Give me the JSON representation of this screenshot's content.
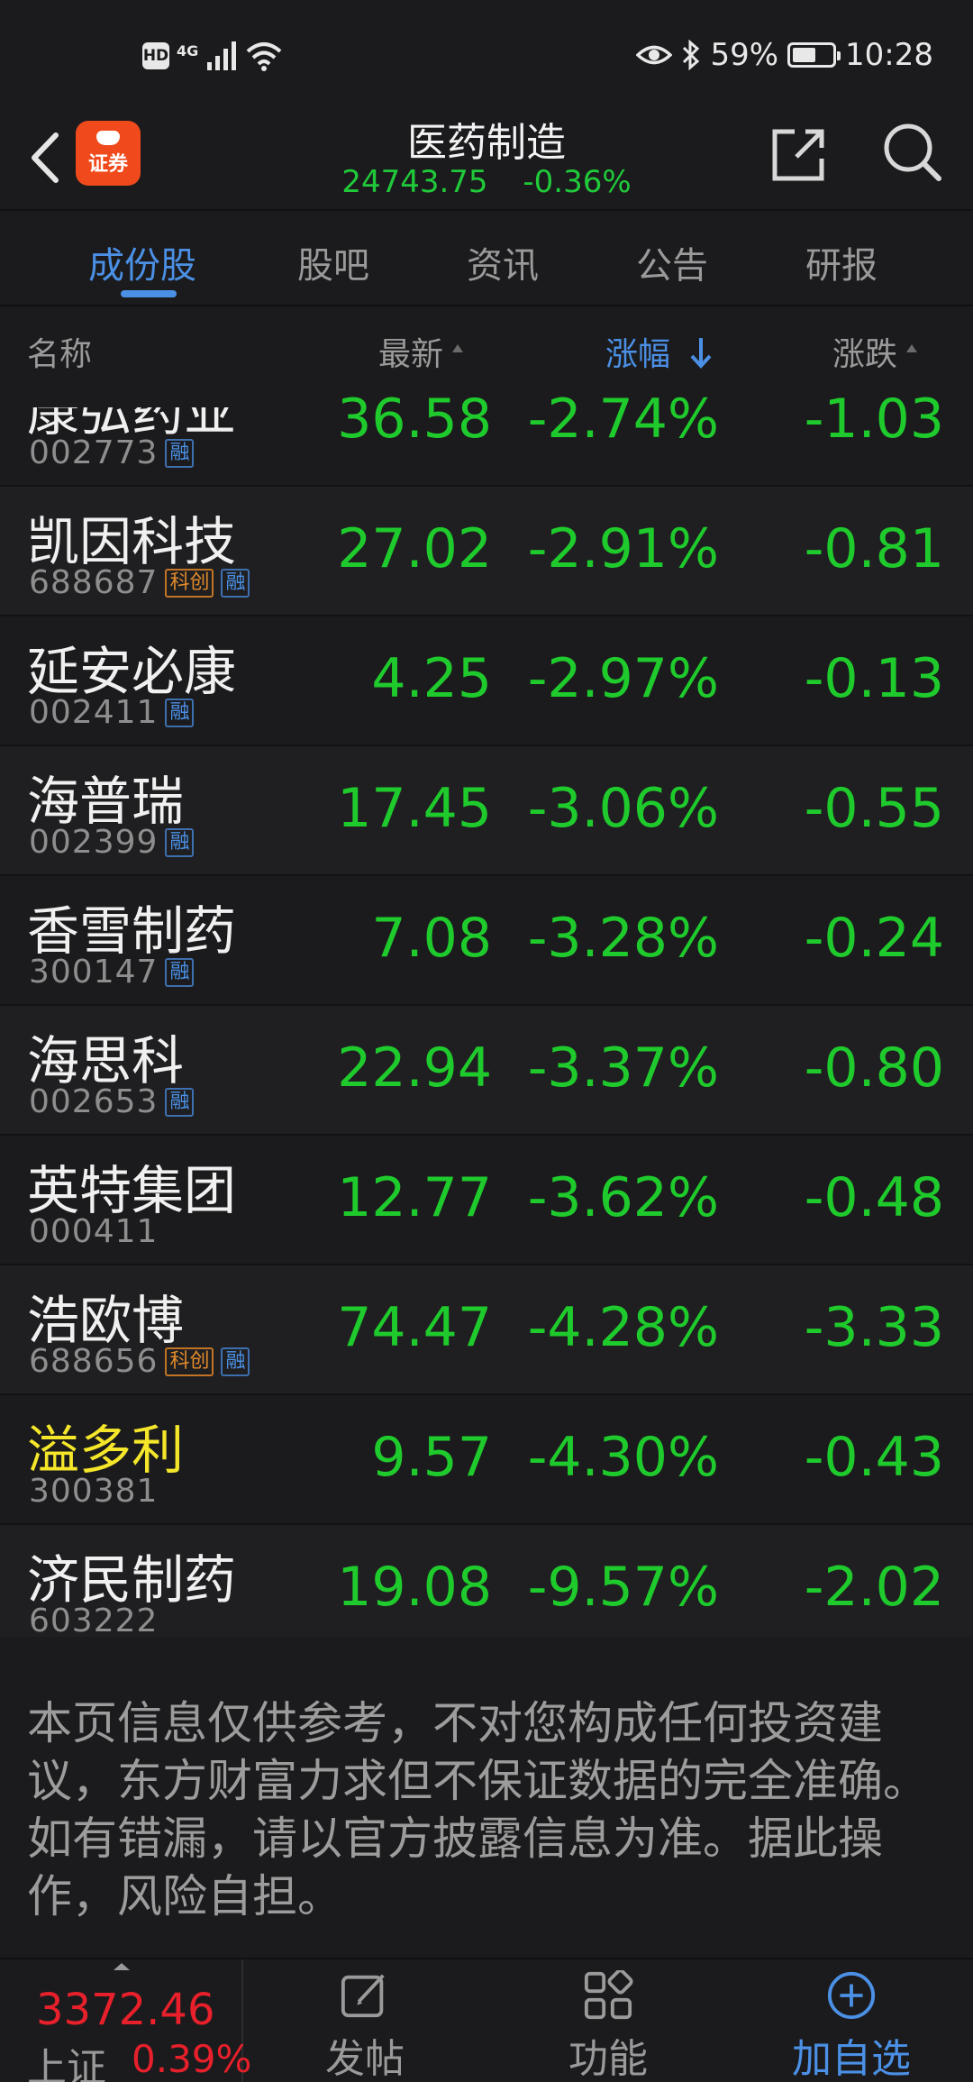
{
  "status_bar": {
    "left_badge": "HD",
    "network": "4G",
    "battery": "59%",
    "battery_level": 0.59,
    "time": "10:28"
  },
  "header": {
    "logo_text": "证券",
    "title": "医药制造",
    "index_value": "24743.75",
    "index_change": "-0.36%"
  },
  "tabs": [
    {
      "label": "成份股",
      "active": true
    },
    {
      "label": "股吧",
      "active": false
    },
    {
      "label": "资讯",
      "active": false
    },
    {
      "label": "公告",
      "active": false
    },
    {
      "label": "研报",
      "active": false
    }
  ],
  "columns": {
    "name": "名称",
    "latest": "最新",
    "pct": "涨幅",
    "change": "涨跌",
    "sorted_by": "涨幅",
    "sort_direction": "down"
  },
  "rows": [
    {
      "name": "康弘药业",
      "code": "002773",
      "tags": [
        "融"
      ],
      "price": "36.58",
      "pct": "-2.74%",
      "change": "-1.03",
      "partial": true
    },
    {
      "name": "凯因科技",
      "code": "688687",
      "tags": [
        "科创",
        "融"
      ],
      "price": "27.02",
      "pct": "-2.91%",
      "change": "-0.81"
    },
    {
      "name": "延安必康",
      "code": "002411",
      "tags": [
        "融"
      ],
      "price": "4.25",
      "pct": "-2.97%",
      "change": "-0.13"
    },
    {
      "name": "海普瑞",
      "code": "002399",
      "tags": [
        "融"
      ],
      "price": "17.45",
      "pct": "-3.06%",
      "change": "-0.55"
    },
    {
      "name": "香雪制药",
      "code": "300147",
      "tags": [
        "融"
      ],
      "price": "7.08",
      "pct": "-3.28%",
      "change": "-0.24"
    },
    {
      "name": "海思科",
      "code": "002653",
      "tags": [
        "融"
      ],
      "price": "22.94",
      "pct": "-3.37%",
      "change": "-0.80"
    },
    {
      "name": "英特集团",
      "code": "000411",
      "tags": [],
      "price": "12.77",
      "pct": "-3.62%",
      "change": "-0.48"
    },
    {
      "name": "浩欧博",
      "code": "688656",
      "tags": [
        "科创",
        "融"
      ],
      "price": "74.47",
      "pct": "-4.28%",
      "change": "-3.33"
    },
    {
      "name": "溢多利",
      "code": "300381",
      "tags": [],
      "price": "9.57",
      "pct": "-4.30%",
      "change": "-0.43",
      "highlight": true
    },
    {
      "name": "济民制药",
      "code": "603222",
      "tags": [],
      "price": "19.08",
      "pct": "-9.57%",
      "change": "-2.02"
    }
  ],
  "disclaimer": "本页信息仅供参考，不对您构成任何投资建议，东方财富力求但不保证数据的完全准确。如有错漏，请以官方披露信息为准。据此操作，风险自担。",
  "bottom_bar": {
    "index_value": "3372.46",
    "index_name": "上证",
    "index_pct": "0.39%",
    "post_label": "发帖",
    "functions_label": "功能",
    "add_watch_label": "加自选"
  },
  "colors": {
    "accent": "#4b90e5",
    "down": "#1fcb2c",
    "up": "#e8202b",
    "highlight": "#f5e62a",
    "logo": "#f04a1c"
  }
}
